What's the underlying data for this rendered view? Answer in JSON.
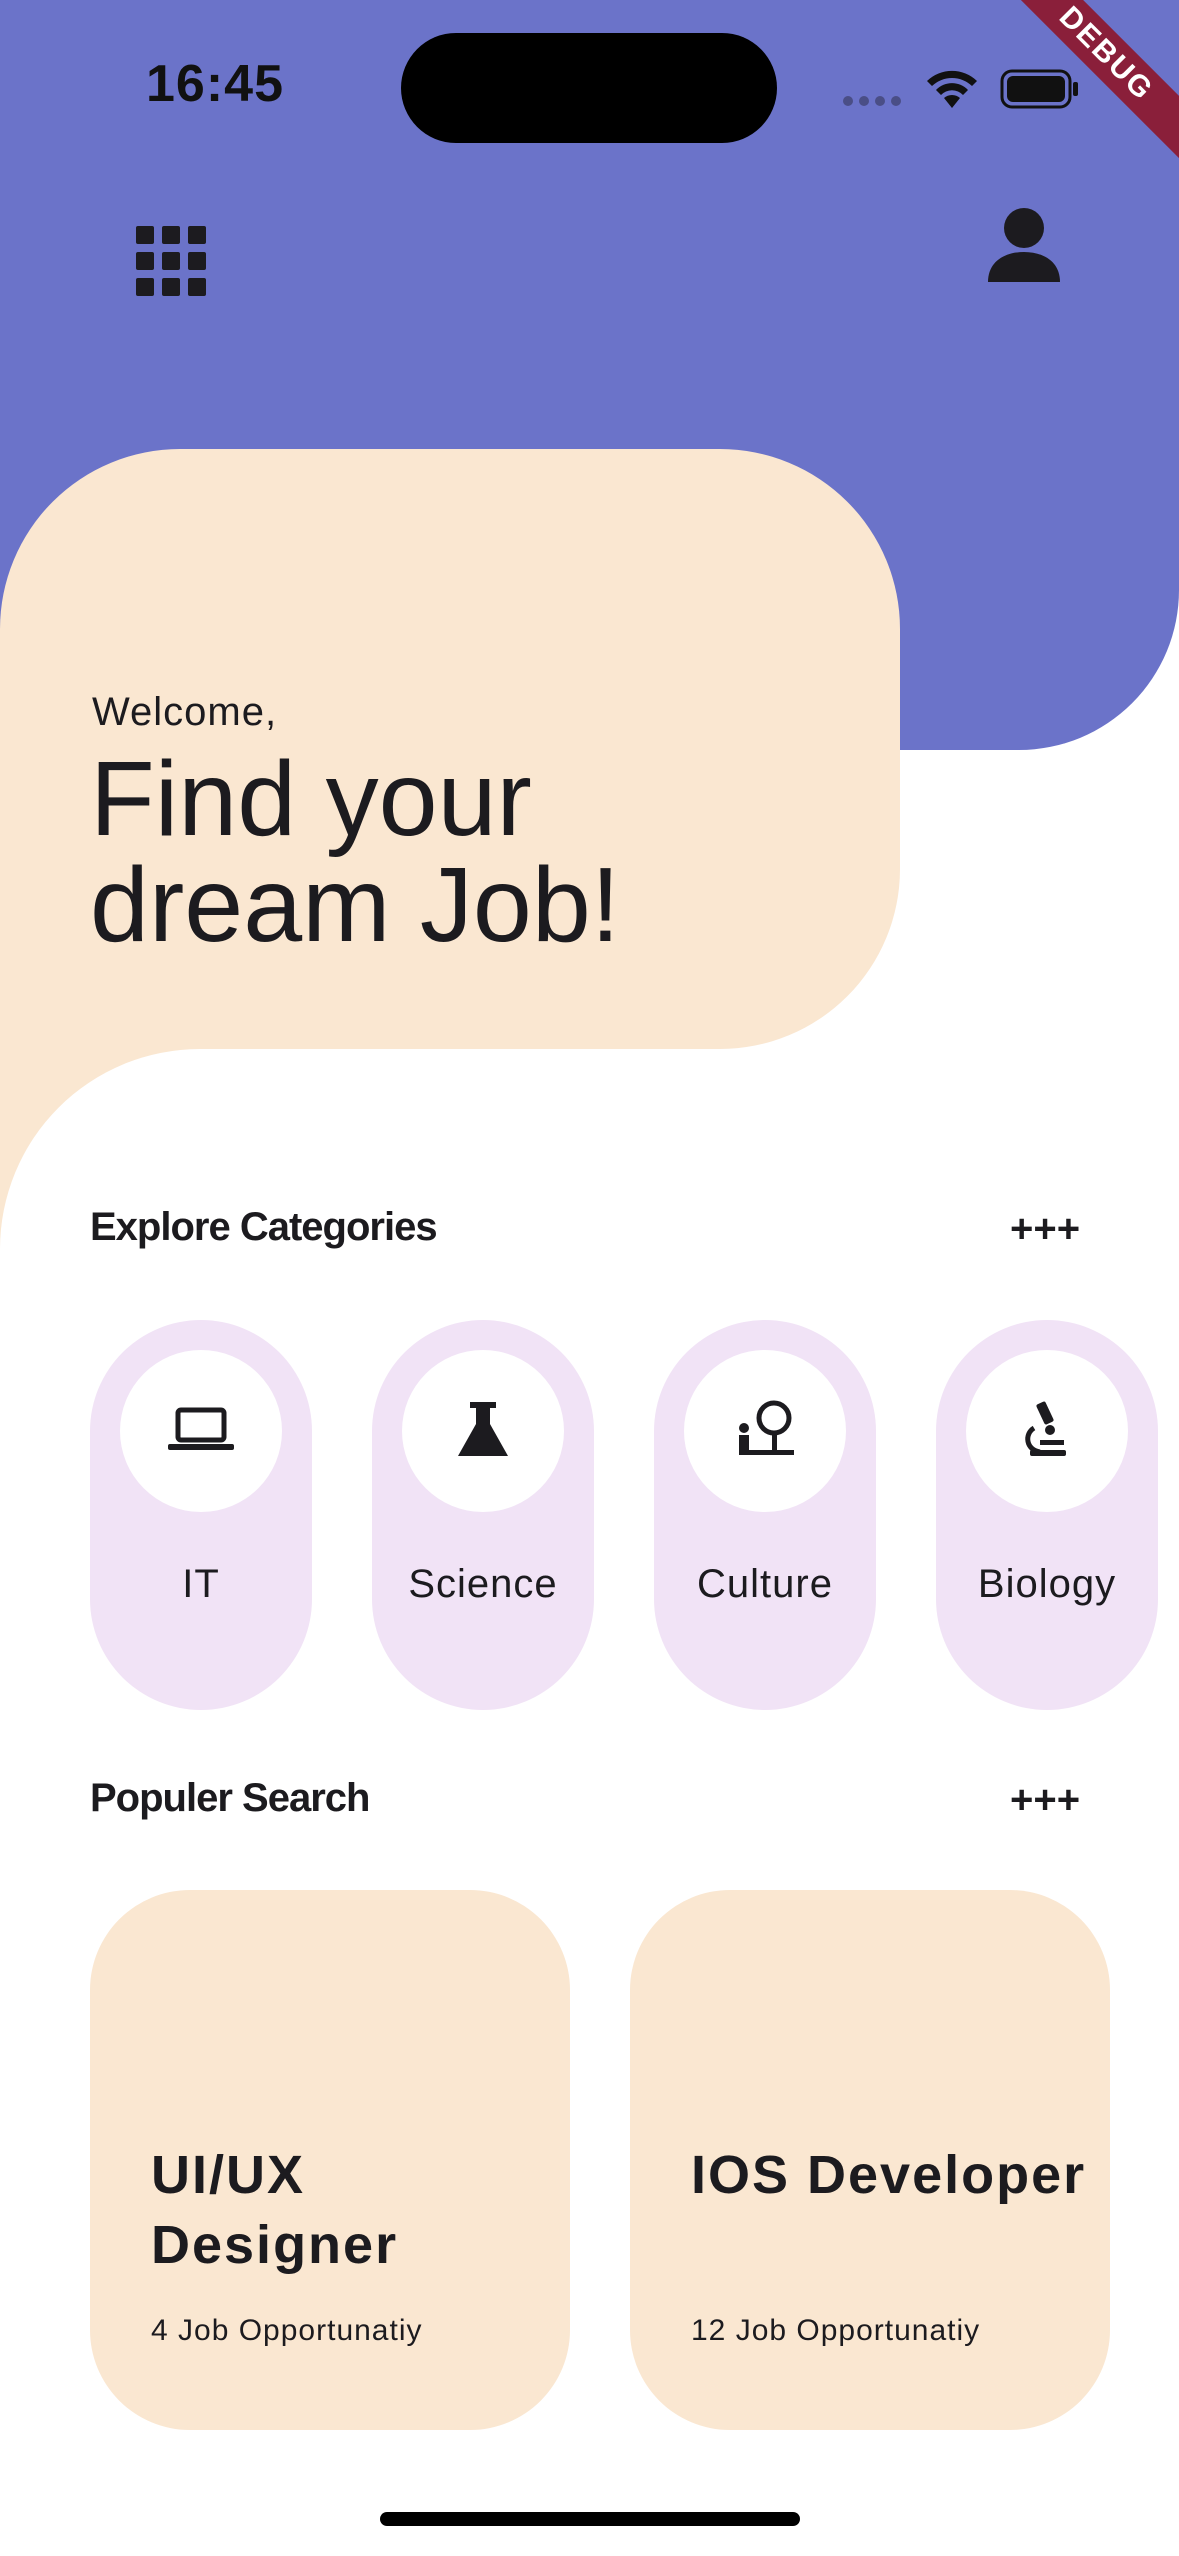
{
  "status_bar": {
    "time": "16:45",
    "debug_label": "DEBUG"
  },
  "header": {
    "menu_icon": "grid-menu-icon",
    "profile_icon": "person-icon"
  },
  "welcome": {
    "greeting": "Welcome,",
    "title": "Find your dream Job!"
  },
  "categories_section": {
    "title": "Explore Categories",
    "more_label": "+++",
    "items": [
      {
        "label": "IT",
        "icon": "laptop-icon"
      },
      {
        "label": "Science",
        "icon": "flask-icon"
      },
      {
        "label": "Culture",
        "icon": "museum-icon"
      },
      {
        "label": "Biology",
        "icon": "microscope-icon"
      }
    ]
  },
  "popular_section": {
    "title": "Populer Search",
    "more_label": "+++",
    "cards": [
      {
        "title": "UI/UX Designer",
        "count": "4 Job Opportunatiy"
      },
      {
        "title": "IOS Developer",
        "count": "12 Job Opportunatiy"
      }
    ]
  },
  "colors": {
    "header_purple": "#6b73c9",
    "cream": "#fae7d1",
    "category_lavender": "#f1e3f6",
    "debug_red": "#8a1f3a"
  }
}
